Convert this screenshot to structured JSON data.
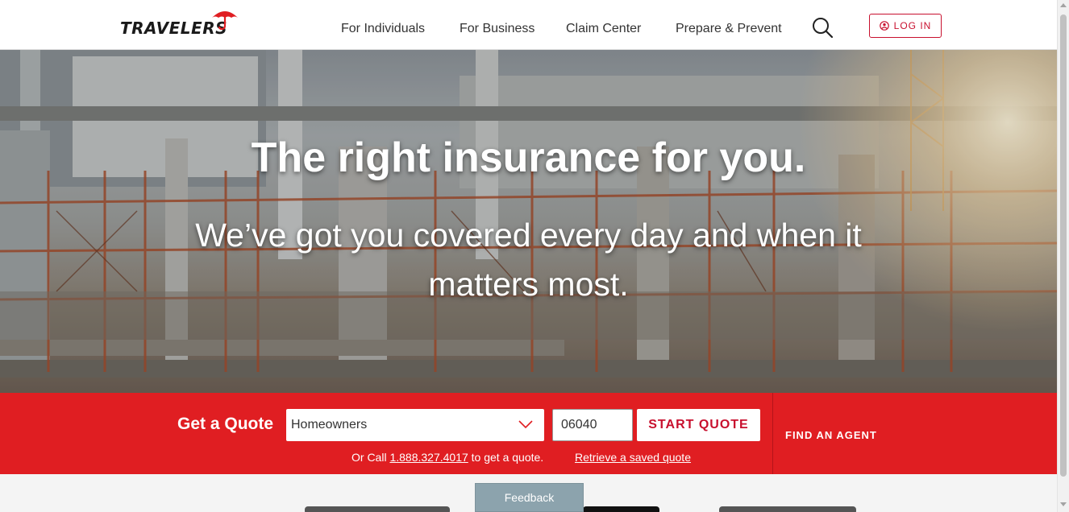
{
  "header": {
    "brand": "TRAVELERS",
    "nav": [
      {
        "label": "For Individuals"
      },
      {
        "label": "For Business"
      },
      {
        "label": "Claim Center"
      },
      {
        "label": "Prepare & Prevent"
      }
    ],
    "search_icon": "search-icon",
    "login_label": "LOG IN",
    "login_icon": "user-circle-icon"
  },
  "hero": {
    "title": "The right insurance for you.",
    "subtitle": "We’ve got you covered every day and when it matters most."
  },
  "quote": {
    "label": "Get a Quote",
    "product_selected": "Homeowners",
    "zip_value": "06040",
    "start_label": "START QUOTE",
    "call_prefix": "Or Call",
    "phone": "1.888.327.4017",
    "call_suffix": "to get a quote.",
    "retrieve_label": "Retrieve a saved quote",
    "find_agent_label": "FIND AN AGENT"
  },
  "feedback_label": "Feedback",
  "colors": {
    "brand_red": "#e01e22",
    "accent_red": "#c8102e",
    "feedback_bg": "#8ca3ad"
  }
}
